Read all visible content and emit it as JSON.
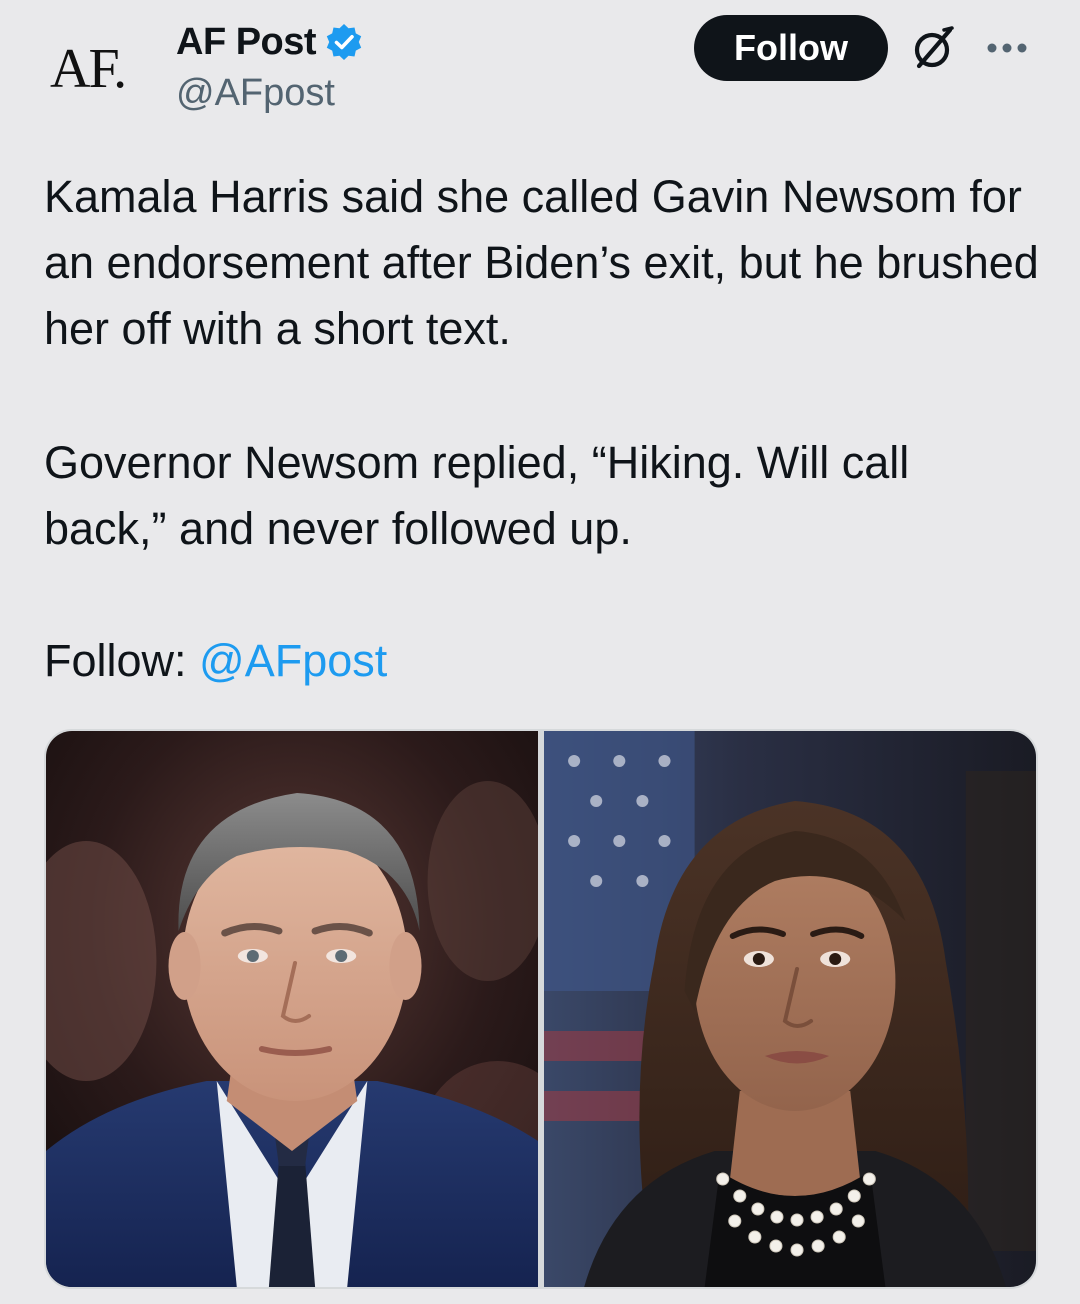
{
  "author": {
    "avatar_text": "AF.",
    "display_name": "AF Post",
    "handle": "@AFpost",
    "verified": true
  },
  "actions": {
    "follow_label": "Follow"
  },
  "post": {
    "paragraph_1": "Kamala Harris said she called Gavin Newsom for an endorsement after Biden’s exit, but he brushed her off with a short text.",
    "paragraph_2": "Governor Newsom replied, “Hiking. Will call back,” and never followed up.",
    "follow_prefix": "Follow: ",
    "follow_mention": "@AFpost"
  },
  "media": {
    "photos": [
      {
        "subject": "gray-haired man in navy suit and dark tie"
      },
      {
        "subject": "woman with shoulder-length brown hair and pearl necklace"
      }
    ]
  },
  "colors": {
    "background": "#e9e9eb",
    "text": "#0f1419",
    "secondary_text": "#536471",
    "accent": "#1d9bf0",
    "follow_button": "#0f1419"
  },
  "icons": {
    "verified": "verified-badge-icon",
    "grok": "grok-icon",
    "more": "more-icon"
  }
}
